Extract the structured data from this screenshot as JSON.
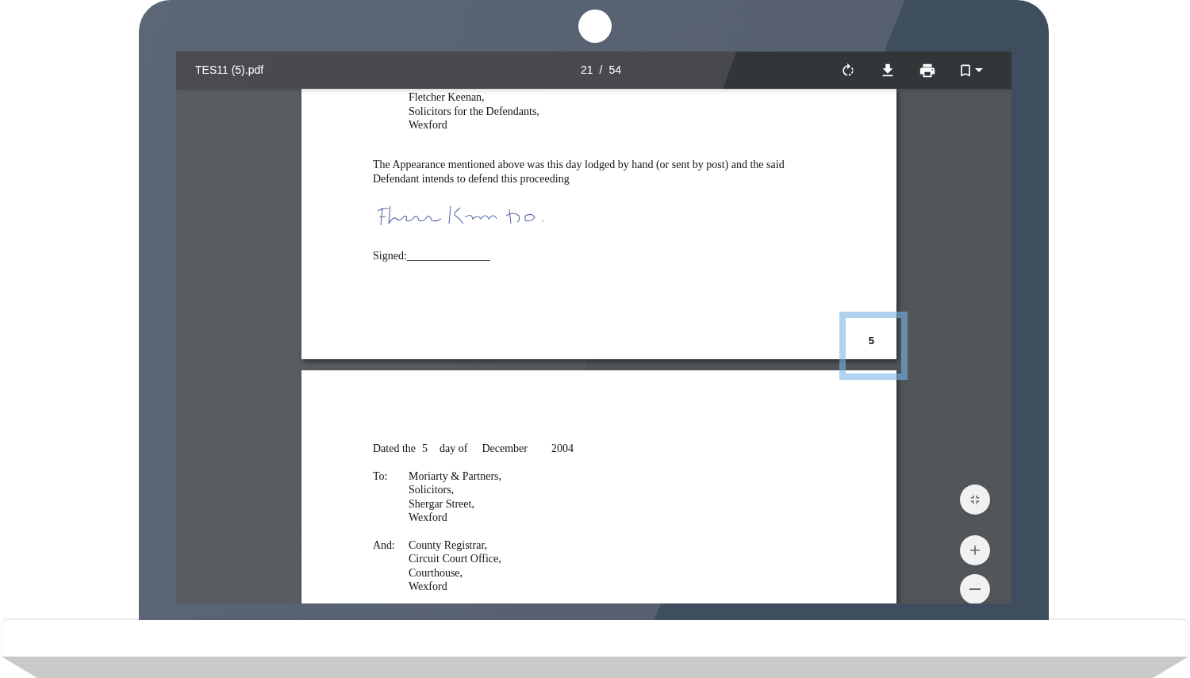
{
  "viewer": {
    "file_name": "TES11 (5).pdf",
    "page_indicator": {
      "current": "21",
      "separator": "/",
      "total": "54"
    }
  },
  "page_1": {
    "address_lines": [
      "Fletcher Keenan,",
      "Solicitors for the Defendants,",
      "Wexford"
    ],
    "paragraph": "The Appearance mentioned above was this day lodged by hand (or sent by post) and the said Defendant intends to defend this proceeding",
    "signed_label": "Signed:_______________",
    "page_number": "5",
    "page_number_highlighted": true
  },
  "page_2": {
    "dated": {
      "prefix": "Dated the",
      "day": "5",
      "middle": "day of",
      "month": "December",
      "year": "2004"
    },
    "recipients": [
      {
        "label": "To:",
        "lines": [
          "Moriarty & Partners,",
          "Solicitors,",
          "Shergar Street,",
          "Wexford"
        ]
      },
      {
        "label": "And:",
        "lines": [
          "County Registrar,",
          "Circuit Court Office,",
          "Courthouse,",
          "Wexford"
        ]
      }
    ]
  }
}
